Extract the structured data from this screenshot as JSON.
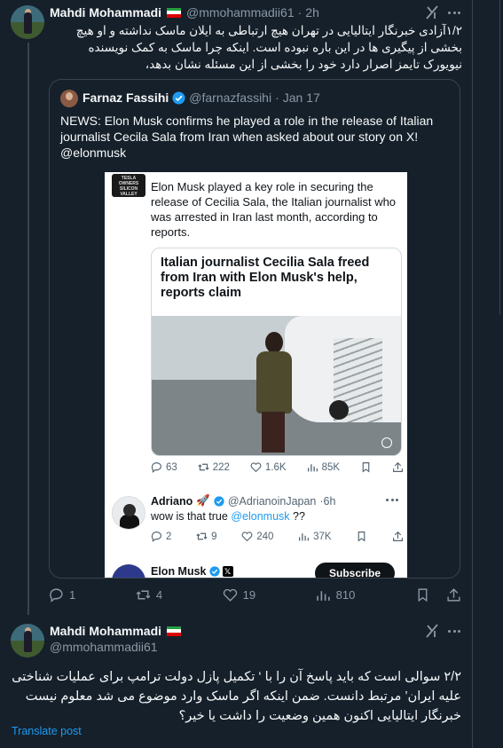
{
  "tweet1": {
    "author_name": "Mahdi Mohammadi",
    "handle": "@mmohammadii61",
    "separator": "·",
    "time": "2h",
    "text": "۱/۲آزادی خبرنگار ایتالیایی در تهران هیچ ارتباطی به ایلان ماسک نداشته و او هیچ بخشی از پیگیری ها در این باره نبوده است. اینکه چرا ماسک به کمک نویسنده نیویورک تایمز اصرار دارد خود را بخشی از این مسئله نشان بدهد،",
    "quote": {
      "author_name": "Farnaz Fassihi",
      "handle": "@farnazfassihi",
      "separator": "·",
      "date": "Jan 17",
      "text_line1": "NEWS: Elon Musk confirms he played a role in the release of Italian",
      "text_line2": "journalist Cecila Sala from Iran when asked about our story on X!",
      "text_line3": "@elonmusk",
      "screenshot": {
        "top_text": "Tesla Owners Silicon Valley",
        "logo_text": "TESLA OWNERS SILICON VALLEY",
        "post_text": "Elon Musk played a key role in securing the release of Cecilia Sala, the Italian journalist who was arrested in Iran last month, according to reports.",
        "headline": "Italian journalist Cecilia Sala freed from Iran with Elon Musk's help, reports claim",
        "stats": {
          "replies": "63",
          "reposts": "222",
          "likes": "1.6K",
          "views": "85K"
        },
        "reply": {
          "name": "Adriano",
          "rocket": "🚀",
          "handle": "@AdrianoinJapan",
          "time": "·6h",
          "text_prefix": "wow is that true ",
          "mention": "@elonmusk",
          "text_suffix": " ??",
          "stats": {
            "replies": "2",
            "reposts": "9",
            "likes": "240",
            "views": "37K"
          }
        },
        "musk": {
          "name": "Elon Musk",
          "badge_x": "𝕏",
          "subscribe": "Subscribe"
        }
      }
    },
    "stats": {
      "replies": "1",
      "reposts": "4",
      "likes": "19",
      "views": "810"
    }
  },
  "tweet2": {
    "author_name": "Mahdi Mohammadi",
    "handle": "@mmohammadii61",
    "text": "۲/۲ سوالی است که باید پاسخ آن را با ‘ تکمیل پازل دولت ترامپ برای عملیات شناختی علیه ایران’ مرتبط دانست. ضمن اینکه اگر ماسک وارد موضوع می شد معلوم نیست خبرنگار ایتالیایی اکنون همین وضعیت را داشت یا خیر؟",
    "translate": "Translate post"
  },
  "colors": {
    "background": "#15202b",
    "text": "#f7f9f9",
    "muted": "#8b98a5",
    "accent": "#1d9bf0",
    "border": "#38444d"
  },
  "icons": [
    "grok-icon",
    "more-icon",
    "reply-icon",
    "repost-icon",
    "like-icon",
    "views-icon",
    "bookmark-icon",
    "share-icon",
    "verified-icon",
    "iran-flag-icon"
  ]
}
